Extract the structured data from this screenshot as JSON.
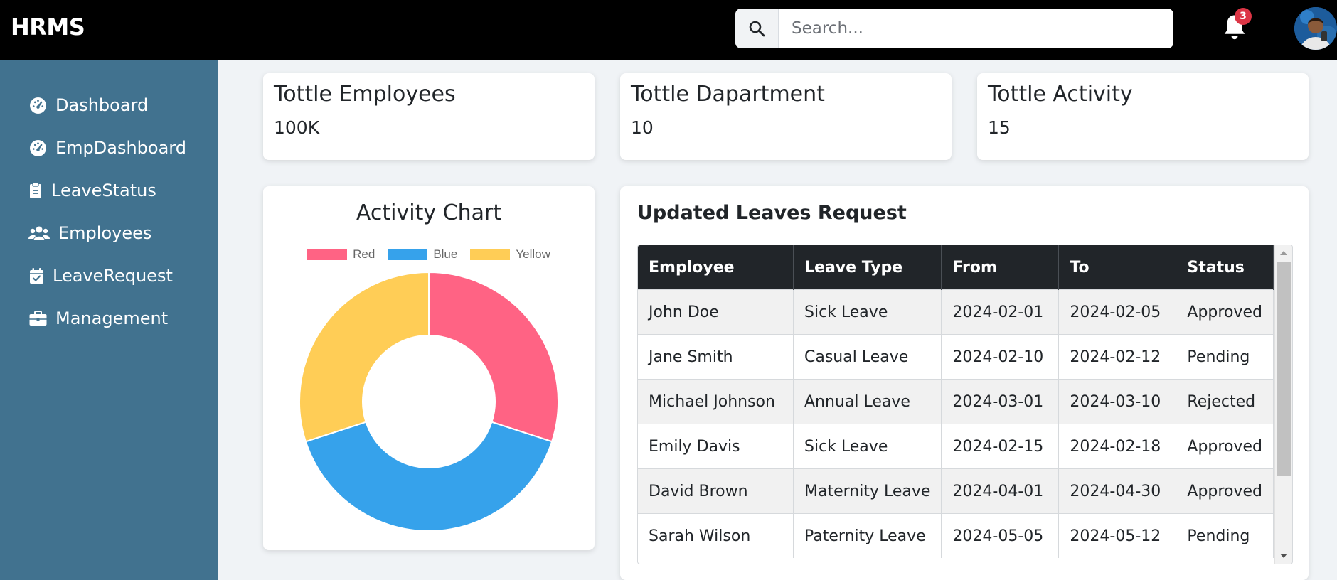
{
  "app": {
    "title": "HRMS"
  },
  "search": {
    "placeholder": "Search..."
  },
  "notifications": {
    "count": "3"
  },
  "colors": {
    "sidebar": "#41728f",
    "topbar": "#000000",
    "badge": "#dc3545"
  },
  "sidebar": {
    "items": [
      {
        "label": "Dashboard",
        "icon": "gauge-icon"
      },
      {
        "label": "EmpDashboard",
        "icon": "gauge-icon"
      },
      {
        "label": "LeaveStatus",
        "icon": "clipboard-icon"
      },
      {
        "label": "Employees",
        "icon": "users-icon"
      },
      {
        "label": "LeaveRequest",
        "icon": "calendar-check-icon"
      },
      {
        "label": "Management",
        "icon": "briefcase-icon"
      }
    ]
  },
  "stats": [
    {
      "title": "Tottle Employees",
      "value": "100K"
    },
    {
      "title": "Tottle Dapartment",
      "value": "10"
    },
    {
      "title": "Tottle Activity",
      "value": "15"
    }
  ],
  "chart_card": {
    "title": "Activity Chart"
  },
  "chart_data": {
    "type": "pie",
    "variant": "doughnut",
    "title": "Activity Chart",
    "legend_position": "top",
    "labels": [
      "Red",
      "Blue",
      "Yellow"
    ],
    "values": [
      30,
      40,
      30
    ],
    "colors": [
      "#ff6384",
      "#36a2eb",
      "#ffcd56"
    ]
  },
  "leaves": {
    "title": "Updated Leaves Request",
    "columns": [
      "Employee",
      "Leave Type",
      "From",
      "To",
      "Status"
    ],
    "rows": [
      [
        "John Doe",
        "Sick Leave",
        "2024-02-01",
        "2024-02-05",
        "Approved"
      ],
      [
        "Jane Smith",
        "Casual Leave",
        "2024-02-10",
        "2024-02-12",
        "Pending"
      ],
      [
        "Michael Johnson",
        "Annual Leave",
        "2024-03-01",
        "2024-03-10",
        "Rejected"
      ],
      [
        "Emily Davis",
        "Sick Leave",
        "2024-02-15",
        "2024-02-18",
        "Approved"
      ],
      [
        "David Brown",
        "Maternity Leave",
        "2024-04-01",
        "2024-04-30",
        "Approved"
      ],
      [
        "Sarah Wilson",
        "Paternity Leave",
        "2024-05-05",
        "2024-05-12",
        "Pending"
      ]
    ]
  }
}
